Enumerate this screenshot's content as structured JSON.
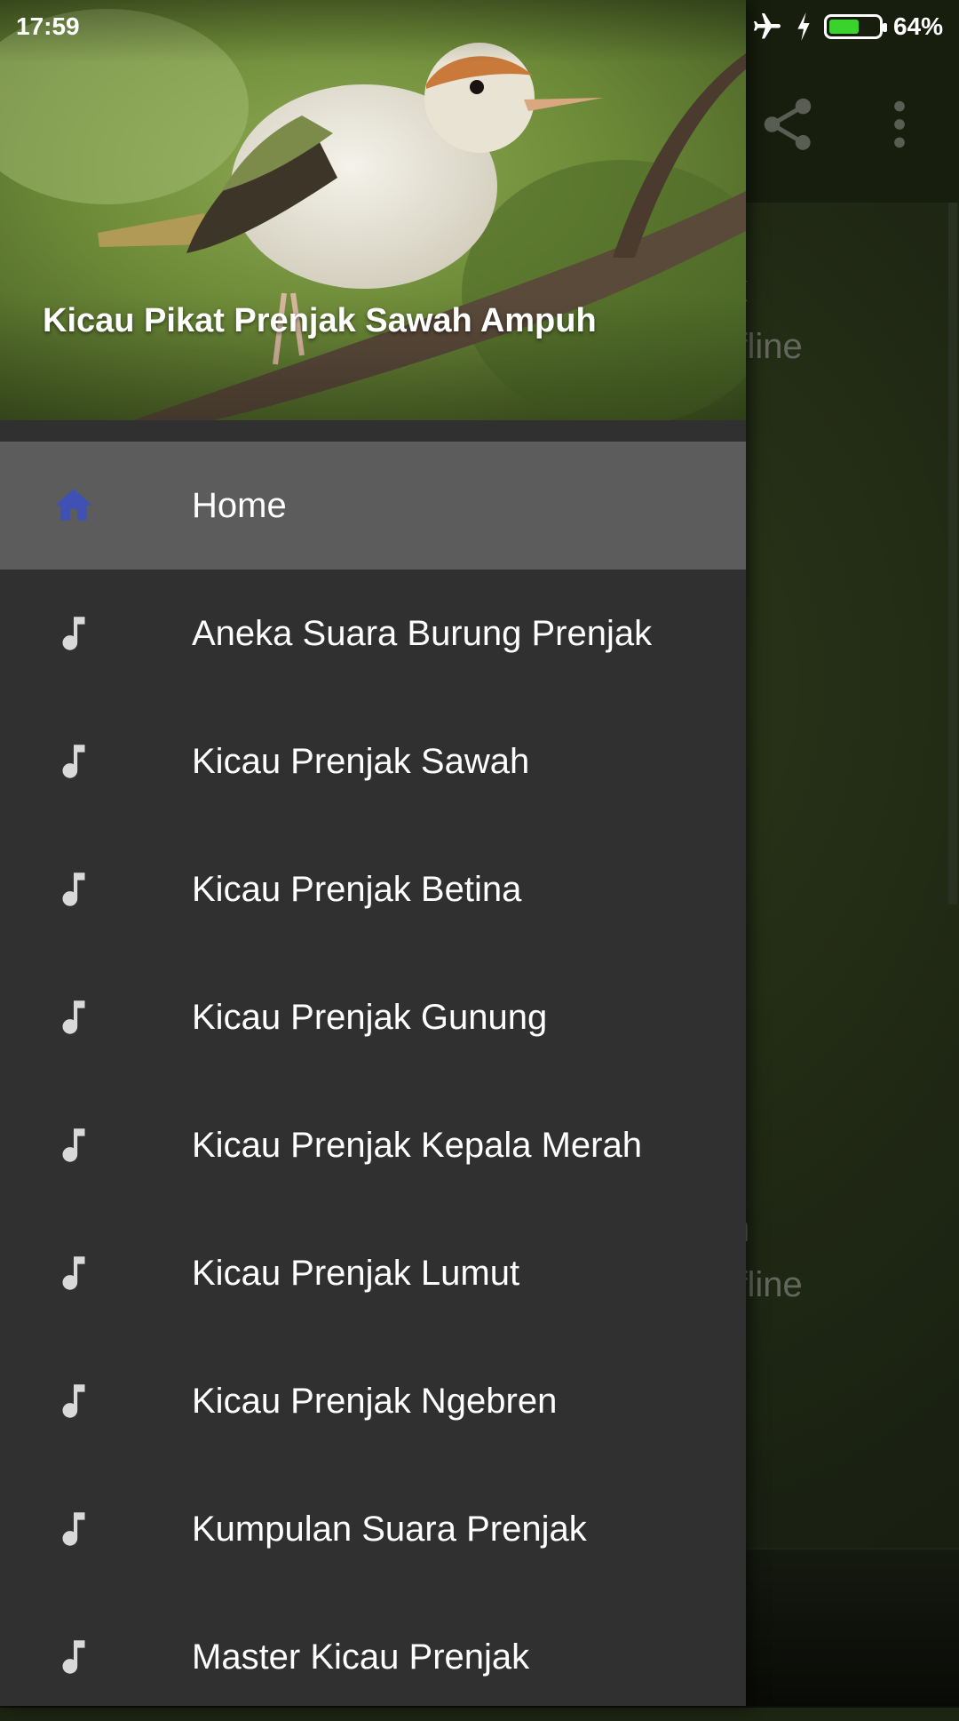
{
  "status_bar": {
    "time": "17:59",
    "battery_percent": "64%",
    "battery_level": 0.64,
    "icons": [
      "airplane-mode-icon",
      "charging-bolt-icon",
      "battery-icon"
    ]
  },
  "app_background": {
    "card_1": {
      "title_fragment": "k",
      "subtitle_fragment": "ffline"
    },
    "card_2": {
      "title_fragment": "n",
      "subtitle_fragment": "ffline"
    },
    "toolbar_icons": [
      "share-icon",
      "more-vert-icon"
    ]
  },
  "drawer": {
    "header_title": "Kicau Pikat Prenjak Sawah Ampuh",
    "items": [
      {
        "label": "Home",
        "icon": "home-icon",
        "active": true
      },
      {
        "label": "Aneka Suara Burung Prenjak",
        "icon": "music-note-icon",
        "active": false
      },
      {
        "label": "Kicau Prenjak Sawah",
        "icon": "music-note-icon",
        "active": false
      },
      {
        "label": "Kicau Prenjak Betina",
        "icon": "music-note-icon",
        "active": false
      },
      {
        "label": "Kicau Prenjak Gunung",
        "icon": "music-note-icon",
        "active": false
      },
      {
        "label": "Kicau Prenjak Kepala Merah",
        "icon": "music-note-icon",
        "active": false
      },
      {
        "label": "Kicau Prenjak Lumut",
        "icon": "music-note-icon",
        "active": false
      },
      {
        "label": "Kicau Prenjak Ngebren",
        "icon": "music-note-icon",
        "active": false
      },
      {
        "label": "Kumpulan Suara Prenjak",
        "icon": "music-note-icon",
        "active": false
      },
      {
        "label": "Master Kicau Prenjak",
        "icon": "music-note-icon",
        "active": false
      }
    ]
  },
  "colors": {
    "home_icon": "#3f51b5",
    "note_icon": "#d9d9d9",
    "drawer_bg": "#303030",
    "active_bg": "#5c5c5c",
    "battery_fill": "#3bd22e"
  }
}
